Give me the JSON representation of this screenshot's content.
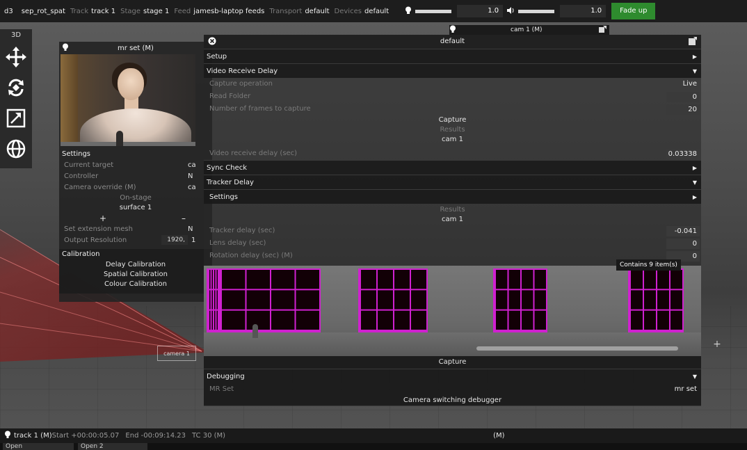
{
  "topbar": {
    "app": "d3",
    "project": "sep_rot_spat",
    "track_label": "Track",
    "track_value": "track 1",
    "stage_label": "Stage",
    "stage_value": "stage 1",
    "feed_label": "Feed",
    "feed_value": "jamesb-laptop feeds",
    "transport_label": "Transport",
    "transport_value": "default",
    "devices_label": "Devices",
    "devices_value": "default",
    "brightness_icon": "bulb-icon",
    "brightness_level": 1.0,
    "brightness_value": "1.0",
    "volume_icon": "speaker-icon",
    "volume_level": 1.0,
    "volume_value": "1.0",
    "fade_label": "Fade up",
    "fade_color": "#2e8b2e"
  },
  "toolbar": {
    "mode": "3D",
    "tools": [
      {
        "name": "move-tool-icon",
        "icon": "four-arrows"
      },
      {
        "name": "rotate-tool-icon",
        "icon": "rotate-arrows"
      },
      {
        "name": "scale-tool-icon",
        "icon": "expand-arrow"
      },
      {
        "name": "globe-tool-icon",
        "icon": "globe"
      }
    ]
  },
  "mrset": {
    "title": "mr set (M)",
    "settings_label": "Settings",
    "rows": [
      {
        "label": "Current target",
        "value": "ca"
      },
      {
        "label": "Controller",
        "value": "N"
      },
      {
        "label": "Camera override (M)",
        "value": "ca"
      }
    ],
    "onstage_label": "On-stage",
    "surface": "surface 1",
    "plus": "+",
    "minus": "–",
    "ext_mesh_label": "Set extension mesh",
    "ext_mesh_value": "N",
    "output_res_label": "Output Resolution",
    "output_res_value": "1920,",
    "output_res_value2": "1",
    "calibration_label": "Calibration",
    "calibration_items": [
      "Delay Calibration",
      "Spatial Calibration",
      "Colour Calibration"
    ]
  },
  "main": {
    "cam_tab": "cam 1 (M)",
    "title": "default",
    "setup": "Setup",
    "video_receive_delay": "Video Receive Delay",
    "capture_operation_label": "Capture operation",
    "capture_operation_value": "Live",
    "read_folder_label": "Read Folder",
    "read_folder_value": "0",
    "frames_label": "Number of frames to capture",
    "frames_value": "20",
    "capture_label": "Capture",
    "results_label": "Results",
    "cam_name": "cam 1",
    "vrd_sec_label": "Video receive delay (sec)",
    "vrd_sec_value": "0.03338",
    "sync_check": "Sync Check",
    "tracker_delay": "Tracker Delay",
    "settings": "Settings",
    "results2": "Results",
    "cam_name2": "cam 1",
    "tracker_sec_label": "Tracker delay (sec)",
    "tracker_sec_value": "-0.041",
    "lens_delay_label": "Lens delay (sec)",
    "lens_delay_value": "0",
    "rotation_delay_label": "Rotation delay (sec) (M)",
    "rotation_delay_value": "0",
    "contains_tip": "Contains 9 item(s)",
    "capture2": "Capture",
    "debugging": "Debugging",
    "mrset_label": "MR Set",
    "mrset_value": "mr set",
    "switch_debugger": "Camera switching debugger"
  },
  "viewport": {
    "camera_marker": "camera 1"
  },
  "status": {
    "track": "track 1 (M)",
    "start": "Start +00:00:05.07",
    "end": "End -00:09:14.23",
    "tc": "TC 30 (M)",
    "mode": "(M)"
  },
  "bottom_tabs": [
    "Open",
    "Open 2"
  ]
}
